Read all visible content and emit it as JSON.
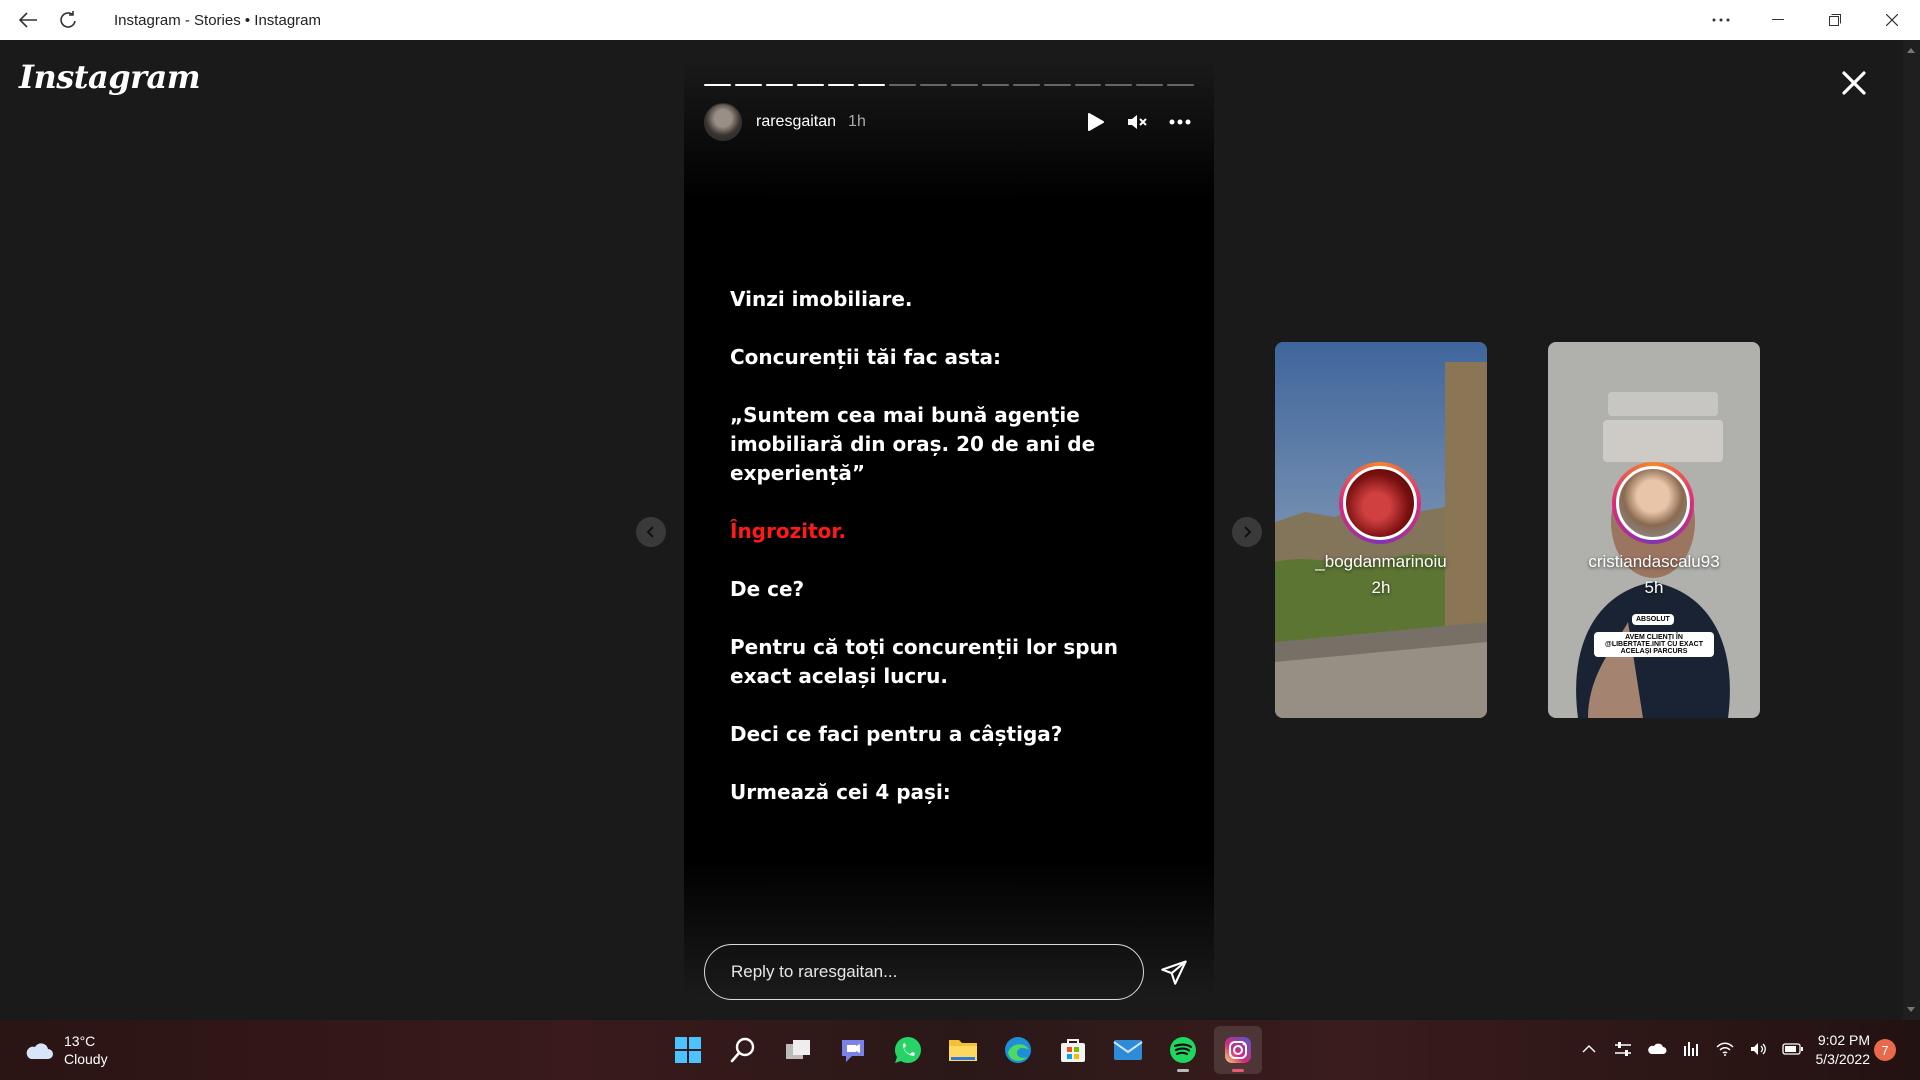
{
  "window": {
    "title": "Instagram - Stories • Instagram"
  },
  "app": {
    "logo": "Instagram"
  },
  "story": {
    "username": "raresgaitan",
    "time": "1h",
    "segments_total": 16,
    "segments_done": 6,
    "lines": [
      "Vinzi imobiliare.",
      "Concurenții tăi fac asta:",
      "„Suntem cea mai bună agenție imobiliară din oraș. 20 de ani de experiență”",
      "Îngrozitor.",
      "De ce?",
      "Pentru că toți concurenții lor spun exact același lucru.",
      "Deci ce faci pentru a câștiga?",
      "Urmează cei 4 pași:"
    ],
    "reply_placeholder": "Reply to raresgaitan..."
  },
  "next_stories": [
    {
      "username": "_bogdanmarinoiu",
      "time": "2h"
    },
    {
      "username": "cristiandascalu93",
      "time": "5h"
    }
  ],
  "preview_texts": {
    "badge": "ABSOLUT",
    "caption": "AVEM CLIENȚI ÎN @LIBERTATE.INIT CU EXACT ACELAȘI PARCURS"
  },
  "taskbar": {
    "weather_temp": "13°C",
    "weather_desc": "Cloudy",
    "time": "9:02 PM",
    "date": "5/3/2022",
    "notification_count": "7",
    "apps": [
      "windows-start",
      "search",
      "task-view",
      "teams-chat",
      "whatsapp",
      "file-explorer",
      "edge",
      "microsoft-store",
      "mail",
      "spotify",
      "instagram"
    ]
  },
  "colors": {
    "accent_red": "#ff1a1a",
    "background": "#1a1a1a",
    "story_bg": "#000000"
  }
}
